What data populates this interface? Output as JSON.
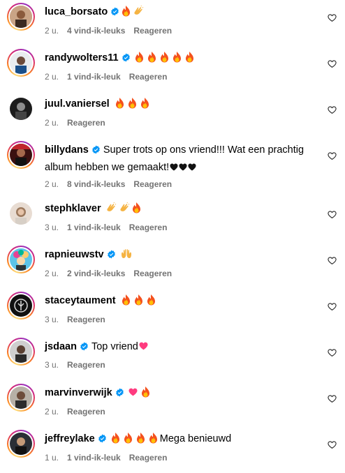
{
  "comments": [
    {
      "username": "luca_borsato",
      "verified": true,
      "text": "",
      "emojis": [
        "fire",
        "clap"
      ],
      "time": "2 u.",
      "likes": "4 vind-ik-leuks",
      "reply": "Reageren",
      "ring": true
    },
    {
      "username": "randywolters11",
      "verified": true,
      "text": "",
      "emojis": [
        "fire",
        "fire",
        "fire",
        "fire",
        "fire"
      ],
      "time": "2 u.",
      "likes": "1 vind-ik-leuk",
      "reply": "Reageren",
      "ring": true
    },
    {
      "username": "juul.vaniersel",
      "verified": false,
      "text": "",
      "emojis": [
        "fire",
        "fire",
        "fire"
      ],
      "time": "2 u.",
      "likes": "",
      "reply": "Reageren",
      "ring": false
    },
    {
      "username": "billydans",
      "verified": true,
      "text_line1": "Super trots op ons vriend!!! Wat een prachtig",
      "text_line2": "album hebben we gemaakt!",
      "emojis_after": [
        "blackheart",
        "blackheart",
        "blackheart"
      ],
      "time": "2 u.",
      "likes": "8 vind-ik-leuks",
      "reply": "Reageren",
      "ring": true
    },
    {
      "username": "stephklaver",
      "verified": false,
      "text": "",
      "emojis": [
        "clap",
        "clap",
        "fire"
      ],
      "time": "3 u.",
      "likes": "1 vind-ik-leuk",
      "reply": "Reageren",
      "ring": false
    },
    {
      "username": "rapnieuwstv",
      "verified": true,
      "text": "",
      "emojis": [
        "raised"
      ],
      "time": "2 u.",
      "likes": "2 vind-ik-leuks",
      "reply": "Reageren",
      "ring": true
    },
    {
      "username": "staceytaument",
      "verified": false,
      "text": "",
      "emojis": [
        "fire",
        "fire",
        "fire"
      ],
      "time": "3 u.",
      "likes": "",
      "reply": "Reageren",
      "ring": true
    },
    {
      "username": "jsdaan",
      "verified": true,
      "text": "Top vriend",
      "emojis_after": [
        "pinkheart"
      ],
      "time": "3 u.",
      "likes": "",
      "reply": "Reageren",
      "ring": true
    },
    {
      "username": "marvinverwijk",
      "verified": true,
      "text": "",
      "emojis": [
        "pinkheart",
        "fire"
      ],
      "time": "2 u.",
      "likes": "",
      "reply": "Reageren",
      "ring": true
    },
    {
      "username": "jeffreylake",
      "verified": true,
      "text": "Mega benieuwd",
      "emojis": [
        "fire",
        "fire",
        "fire",
        "fire"
      ],
      "time": "1 u.",
      "likes": "1 vind-ik-leuk",
      "reply": "Reageren",
      "ring": true
    }
  ],
  "colors": {
    "verified": "#0095f6",
    "meta": "#737373",
    "fire_outer": "#f4511e",
    "fire_inner": "#ffc107",
    "clap": "#f5b342",
    "pink_heart": "#ff3b7f"
  }
}
